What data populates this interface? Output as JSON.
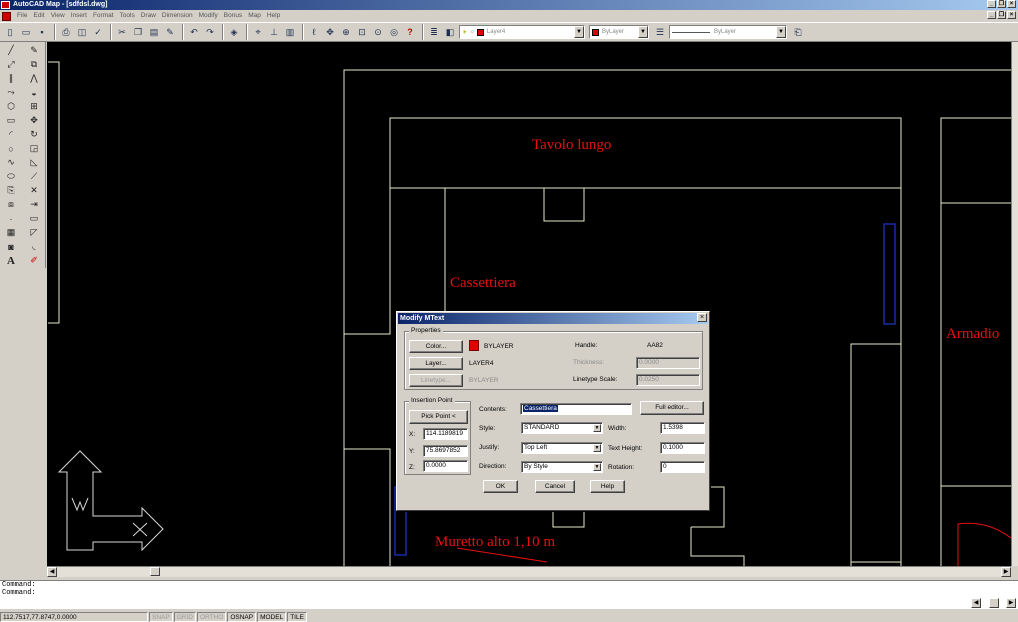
{
  "window": {
    "title": "AutoCAD Map - [sdfdsl.dwg]"
  },
  "menu": [
    "File",
    "Edit",
    "View",
    "Insert",
    "Format",
    "Tools",
    "Draw",
    "Dimension",
    "Modify",
    "Bonus",
    "Map",
    "Help"
  ],
  "toolbar": {
    "layer_combo": "Layer4",
    "color_combo": "ByLayer",
    "linetype_combo": "ByLayer"
  },
  "drawing": {
    "labels": {
      "tavolo": "Tavolo lungo",
      "cassettiera": "Cassettiera",
      "armadio": "Armadio",
      "muretto": "Muretto alto 1,10 m"
    },
    "ucs": {
      "x": "X",
      "y": "W"
    }
  },
  "dialog": {
    "title": "Modify MText",
    "properties": {
      "group_label": "Properties",
      "color_btn": "Color...",
      "color_value": "BYLAYER",
      "layer_btn": "Layer...",
      "layer_value": "LAYER4",
      "linetype_btn": "Linetype...",
      "linetype_value": "BYLAYER",
      "handle_label": "Handle:",
      "handle_value": "AA82",
      "thickness_label": "Thickness:",
      "thickness_value": "0.0000",
      "ltscale_label": "Linetype Scale:",
      "ltscale_value": "0.0250"
    },
    "insertion": {
      "group_label": "Insertion Point",
      "pick_btn": "Pick Point <",
      "x_label": "X:",
      "x_value": "114.1189819",
      "y_label": "Y:",
      "y_value": "75.8697852",
      "z_label": "Z:",
      "z_value": "0.0000"
    },
    "contents_label": "Contents:",
    "contents_value": "Cassettiera",
    "full_editor_btn": "Full editor...",
    "style_label": "Style:",
    "style_value": "STANDARD",
    "justify_label": "Justify:",
    "justify_value": "Top Left",
    "direction_label": "Direction:",
    "direction_value": "By Style",
    "width_label": "Width:",
    "width_value": "1.5398",
    "text_height_label": "Text Height:",
    "text_height_value": "0.1000",
    "rotation_label": "Rotation:",
    "rotation_value": "0",
    "ok_btn": "OK",
    "cancel_btn": "Cancel",
    "help_btn": "Help"
  },
  "command": {
    "line1": "Command:",
    "line2": "Command:"
  },
  "status": {
    "coords": "112.7517,77.8747,0.0000",
    "snap": "SNAP",
    "grid": "GRID",
    "ortho": "ORTHO",
    "osnap": "OSNAP",
    "model": "MODEL",
    "tile": "TILE"
  },
  "colors": {
    "cad_bg": "#000000",
    "cad_line": "#e8e8c8",
    "cad_text": "#e81010",
    "cad_blue": "#1a2aa8",
    "title_blue": "#0a246a"
  }
}
